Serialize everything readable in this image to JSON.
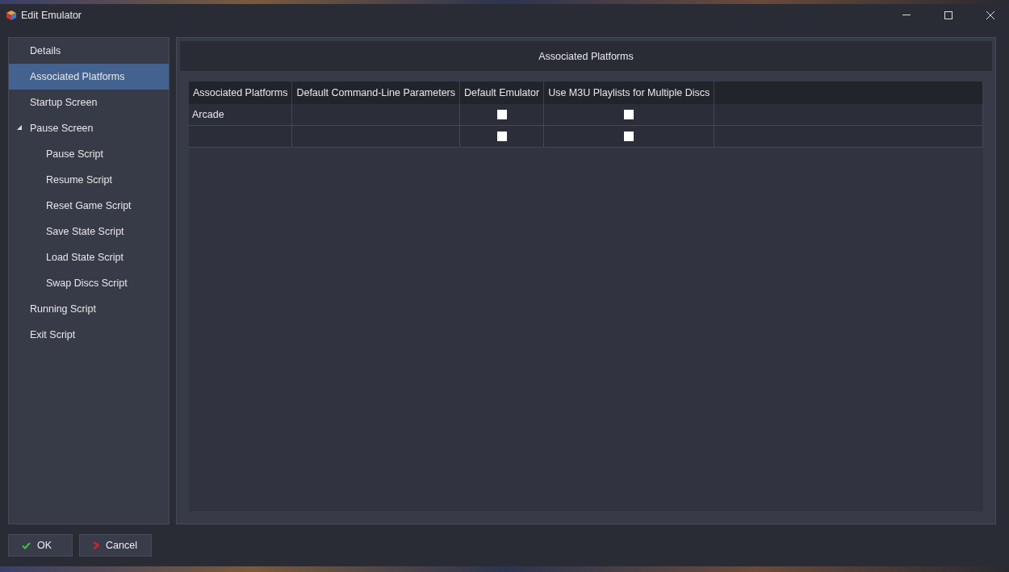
{
  "window": {
    "title": "Edit Emulator"
  },
  "sidebar": {
    "items": [
      {
        "label": "Details",
        "selected": false
      },
      {
        "label": "Associated Platforms",
        "selected": true
      },
      {
        "label": "Startup Screen",
        "selected": false
      },
      {
        "label": "Pause Screen",
        "selected": false,
        "expanded": true,
        "children": [
          {
            "label": "Pause Script",
            "selected": false
          },
          {
            "label": "Resume Script",
            "selected": false
          },
          {
            "label": "Reset Game Script",
            "selected": false
          },
          {
            "label": "Save State Script",
            "selected": false
          },
          {
            "label": "Load State Script",
            "selected": false
          },
          {
            "label": "Swap Discs Script",
            "selected": false
          }
        ]
      },
      {
        "label": "Running Script",
        "selected": false
      },
      {
        "label": "Exit Script",
        "selected": false
      }
    ]
  },
  "panel": {
    "title": "Associated Platforms"
  },
  "table": {
    "columns": [
      "Associated Platforms",
      "Default Command-Line Parameters",
      "Default Emulator",
      "Use M3U Playlists for Multiple Discs"
    ],
    "rows": [
      {
        "platform": "Arcade",
        "default_emulator": false,
        "use_m3u": false
      },
      {
        "default_emulator": false,
        "use_m3u": false
      }
    ]
  },
  "buttons": [
    {
      "kind": "ok",
      "label": "OK"
    },
    {
      "kind": "cancel",
      "label": "Cancel"
    }
  ]
}
